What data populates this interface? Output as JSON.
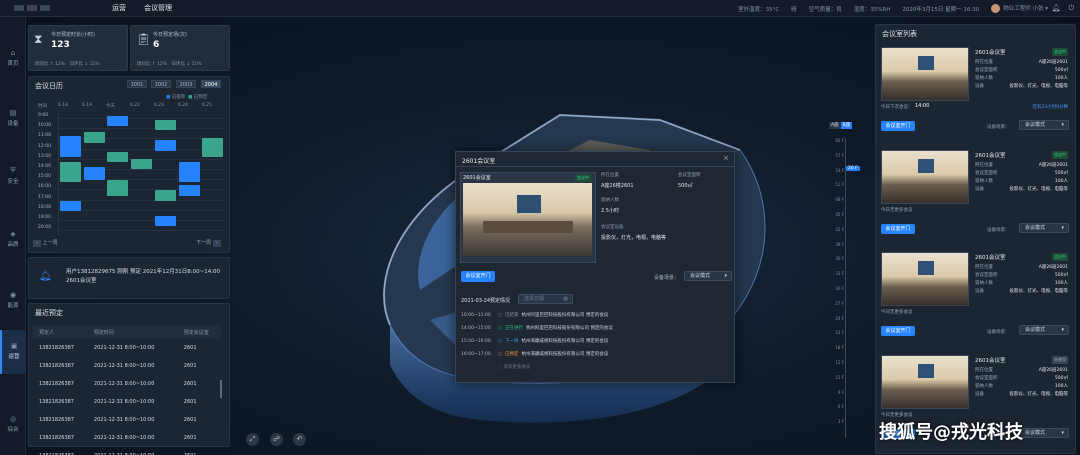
{
  "topbar": {
    "nav_ops": "运营",
    "nav_meeting": "会议管理",
    "temp": "室外温度：35°C",
    "weather": "晴",
    "air": "空气质量：良",
    "humidity": "湿度：35%RH",
    "datetime": "2020年3月15日 星期一 16:30",
    "user": "物业工程师 小张"
  },
  "sidenav": [
    {
      "label": "首页"
    },
    {
      "label": "设备"
    },
    {
      "label": "安全"
    },
    {
      "label": "品质"
    },
    {
      "label": "能源"
    },
    {
      "label": "运营"
    },
    {
      "label": "综合"
    }
  ],
  "stats": [
    {
      "label": "今日预定时长(小时)",
      "value": "123",
      "week": "周同比 ↑ 12%",
      "ring": "日环比 ↓ 11%"
    },
    {
      "label": "今日预定场(次)",
      "value": "6",
      "week": "周同比 ↑ 12%",
      "ring": "日环比 ↓ 11%"
    }
  ],
  "calendar": {
    "title": "会议日历",
    "years": [
      "2001",
      "2002",
      "2003",
      "2004"
    ],
    "legend_booked": "已提单",
    "legend_done": "已预定",
    "headers": [
      "时间",
      "6.18",
      "6.19",
      "今天",
      "6.22",
      "6.23",
      "6.24",
      "6.25"
    ],
    "times": [
      "9:00",
      "10:00",
      "11:00",
      "12:00",
      "13:00",
      "14:00",
      "15:00",
      "16:00",
      "17:00",
      "18:00",
      "19:00",
      "20:00"
    ],
    "prev": "上一周",
    "next": "下一周"
  },
  "notice": {
    "text": "用户13812829675 刚刚 预定 2021年12月31日8:00~14:00 2601会议室"
  },
  "recent": {
    "title": "最近预定",
    "headers": [
      "预定人",
      "预定时间",
      "预定会议室"
    ],
    "rows": [
      [
        "13821826387",
        "2021-12-31 8:00~10:00",
        "2601"
      ],
      [
        "13821826387",
        "2021-12-31 8:00~10:00",
        "2601"
      ],
      [
        "13821826387",
        "2021-12-31 8:00~10:00",
        "2601"
      ],
      [
        "13821826387",
        "2021-12-31 8:00~10:00",
        "2601"
      ],
      [
        "13821826387",
        "2021-12-31 8:00~10:00",
        "2601"
      ],
      [
        "13821826387",
        "2021-12-31 8:00~10:00",
        "2601"
      ],
      [
        "13821826387",
        "2021-12-31 8:00~10:00",
        "2601"
      ]
    ]
  },
  "scale": {
    "tabs": [
      "A座",
      "B座"
    ],
    "floors": [
      "60 F",
      "57 F",
      "54 F",
      "51 F",
      "48 F",
      "45 F",
      "42 F",
      "39 F",
      "36 F",
      "33 F",
      "30 F",
      "27 F",
      "24 F",
      "21 F",
      "18 F",
      "15 F",
      "12 F",
      "9 F",
      "6 F",
      "3 F"
    ],
    "current": "26 F"
  },
  "dialog": {
    "title": "2601会议室",
    "room": "2601会议室",
    "status": "会议中",
    "location_label": "所在位置",
    "location": "A座26楼2601",
    "area_label": "会议室面积",
    "area": "500㎡",
    "capacity_label": "容纳人数",
    "capacity": "2.5小时",
    "equip_label": "会议室设备",
    "equip": "投影仪，灯光，电视，电脑等",
    "open_btn": "会议室开门",
    "mode_label": "设备场景：",
    "mode": "会议模式",
    "date_label": "2021-03-24预定情况",
    "date_ph": "选择日期",
    "items": [
      {
        "time": "10:00~11:00",
        "state": "已结束",
        "desc": "杭州阿里巴巴科技股份有限公司 预定的会议",
        "color": "#8b97a8"
      },
      {
        "time": "14:00~15:00",
        "state": "正在进行",
        "desc": "杭州阿里巴巴科技股份有限公司 预定的会议",
        "color": "#26c281"
      },
      {
        "time": "15:00~16:00",
        "state": "下一场",
        "desc": "杭州海康威视科技股份有限公司 预定的会议",
        "color": "#3e9bff"
      },
      {
        "time": "16:00~17:00",
        "state": "已预定",
        "desc": "杭州海康威视科技股份有限公司 预定的会议",
        "color": "#f39c38"
      }
    ],
    "no_more": "没有更多会议"
  },
  "roomlist": {
    "title": "会议室列表",
    "cards": [
      {
        "name": "2601会议室",
        "status": "会议中",
        "loc": "A座26层2601",
        "area": "500㎡",
        "cap": "100人",
        "equip": "投影仪、灯光、电视、电脑等",
        "note_label": "今日下次会议：",
        "note": "14:00",
        "link": "还有23小时9分钟",
        "open": "会议室开门",
        "mode_label": "设备场景：",
        "mode": "会议模式"
      },
      {
        "name": "2601会议室",
        "status": "会议中",
        "loc": "A座26层2601",
        "area": "500㎡",
        "cap": "100人",
        "equip": "投影仪、灯光、电视、电脑等",
        "note_label": "今日无更多会议",
        "note": "",
        "link": "",
        "open": "会议室开门",
        "mode_label": "设备场景：",
        "mode": "会议模式"
      },
      {
        "name": "2601会议室",
        "status": "会议中",
        "loc": "A座26层2601",
        "area": "500㎡",
        "cap": "100人",
        "equip": "投影仪、灯光、电视、电脑等",
        "note_label": "今日无更多会议",
        "note": "",
        "link": "",
        "open": "会议室开门",
        "mode_label": "设备场景：",
        "mode": "会议模式"
      },
      {
        "name": "2601会议室",
        "status": "未使用",
        "loc": "A座26层2601",
        "area": "500㎡",
        "cap": "100人",
        "equip": "投影仪、灯光、电视、电脑等",
        "note_label": "今日无更多会议",
        "note": "",
        "link": "",
        "open": "会议室开门",
        "mode_label": "设备场景：",
        "mode": "会议模式"
      }
    ],
    "labels": {
      "loc": "所在位置",
      "area": "会议室面积",
      "cap": "容纳人数",
      "equip": "设备"
    }
  },
  "watermark": "搜狐号@戎光科技"
}
